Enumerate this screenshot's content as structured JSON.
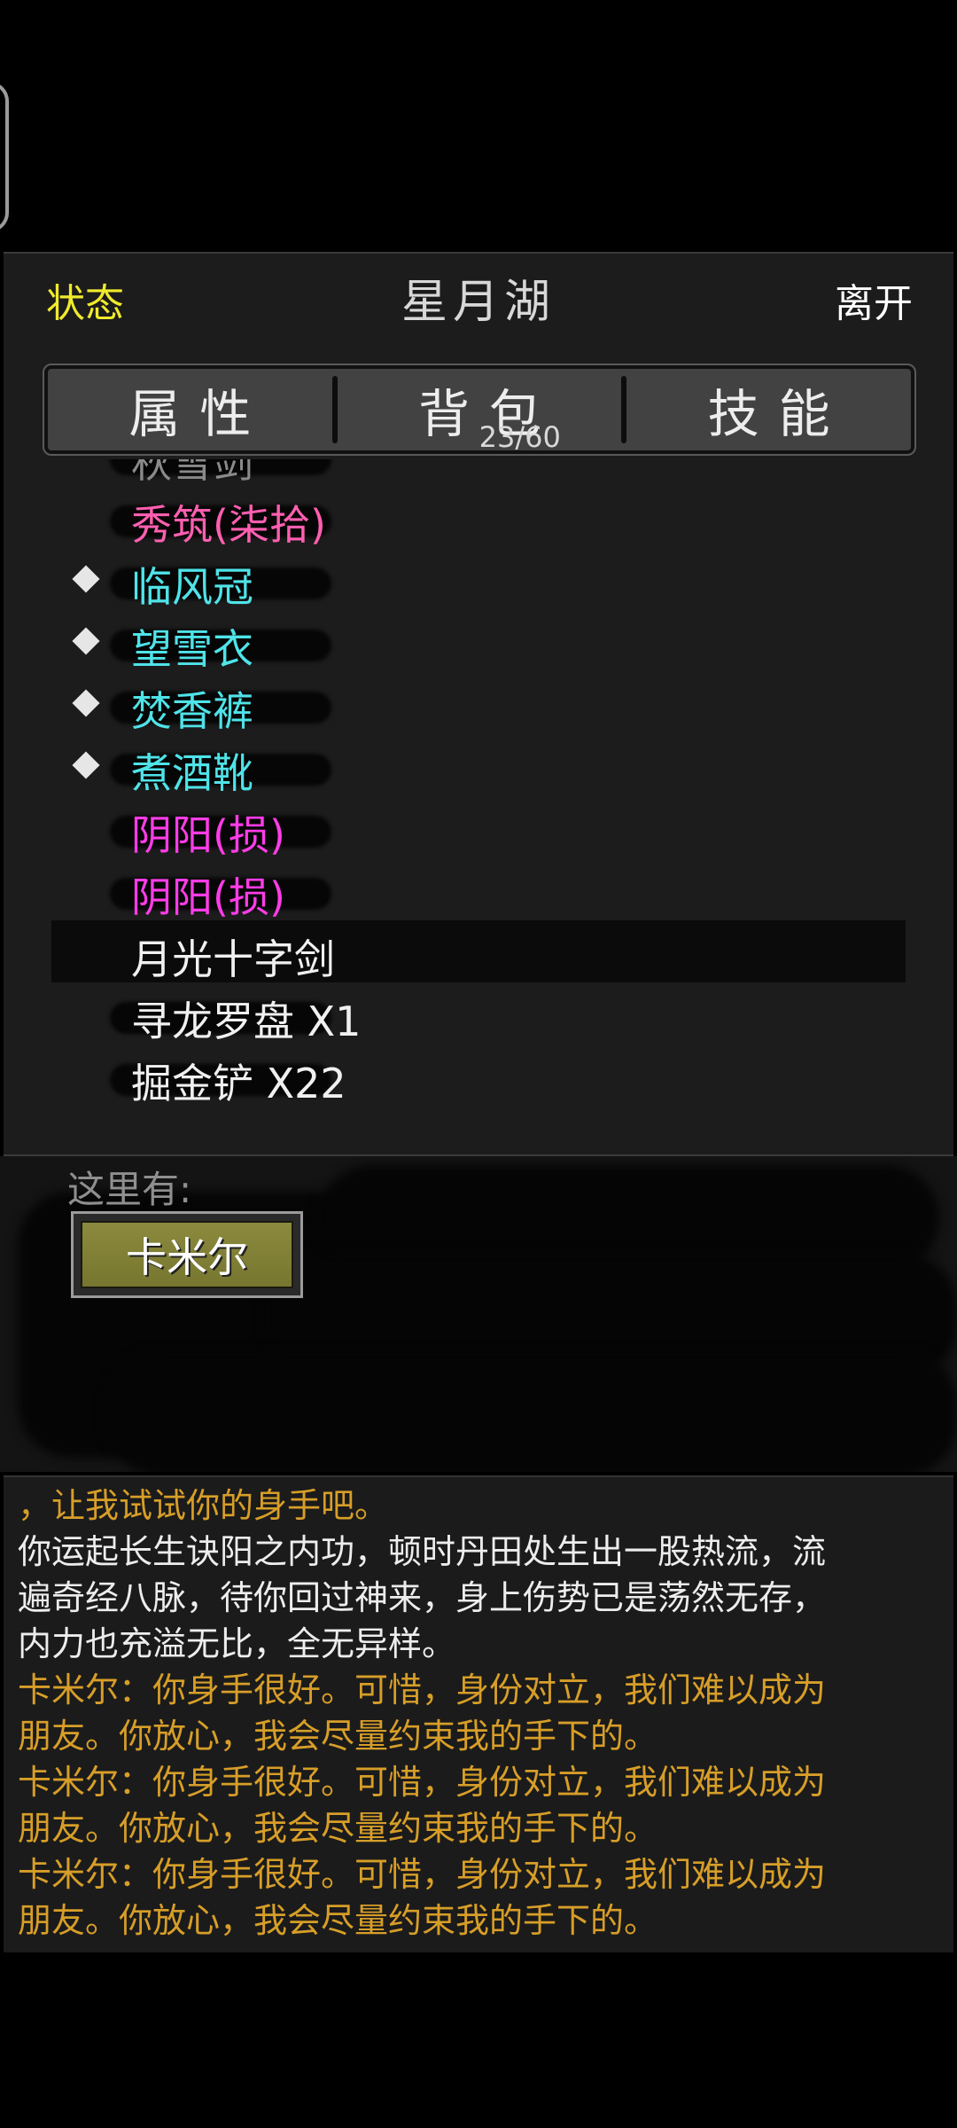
{
  "header": {
    "status_label": "状态",
    "location_title": "星月湖",
    "leave_label": "离开"
  },
  "tabs": [
    {
      "label": "属性"
    },
    {
      "label": "背包",
      "count": "23/60",
      "selected": true
    },
    {
      "label": "技能"
    }
  ],
  "inventory": {
    "partial_top_item": "秋雪剑",
    "items": [
      {
        "name": "秀筑(柒拾)",
        "color": "#ff5fb0",
        "equipped": false
      },
      {
        "name": "临风冠",
        "color": "#4fe3e8",
        "equipped": true
      },
      {
        "name": "望雪衣",
        "color": "#4fe3e8",
        "equipped": true
      },
      {
        "name": "焚香裤",
        "color": "#4fe3e8",
        "equipped": true
      },
      {
        "name": "煮酒靴",
        "color": "#4fe3e8",
        "equipped": true
      },
      {
        "name": "阴阳(损)",
        "color": "#ff3ce8",
        "equipped": false
      },
      {
        "name": "阴阳(损)",
        "color": "#ff3ce8",
        "equipped": false
      },
      {
        "name": "月光十字剑",
        "color": "#f0f0f0",
        "equipped": false,
        "selected": true
      },
      {
        "name": "寻龙罗盘 X1",
        "color": "#f0f0f0",
        "equipped": false
      },
      {
        "name": "掘金铲 X22",
        "color": "#f0f0f0",
        "equipped": false
      }
    ]
  },
  "scene": {
    "here_label": "这里有:",
    "npcs": [
      {
        "name": "卡米尔"
      }
    ]
  },
  "log": {
    "lines": [
      {
        "text": "，让我试试你的身手吧。",
        "color": "gold"
      },
      {
        "text": "你运起长生诀阳之内功，顿时丹田处生出一股热流，流",
        "color": "white"
      },
      {
        "text": "遍奇经八脉，待你回过神来，身上伤势已是荡然无存，",
        "color": "white"
      },
      {
        "text": "内力也充溢无比，全无异样。",
        "color": "white"
      },
      {
        "text": "卡米尔：你身手很好。可惜，身份对立，我们难以成为",
        "color": "gold"
      },
      {
        "text": "朋友。你放心，我会尽量约束我的手下的。",
        "color": "gold"
      },
      {
        "text": "卡米尔：你身手很好。可惜，身份对立，我们难以成为",
        "color": "gold"
      },
      {
        "text": "朋友。你放心，我会尽量约束我的手下的。",
        "color": "gold"
      },
      {
        "text": "卡米尔：你身手很好。可惜，身份对立，我们难以成为",
        "color": "gold"
      },
      {
        "text": "朋友。你放心，我会尽量约束我的手下的。",
        "color": "gold"
      }
    ]
  }
}
